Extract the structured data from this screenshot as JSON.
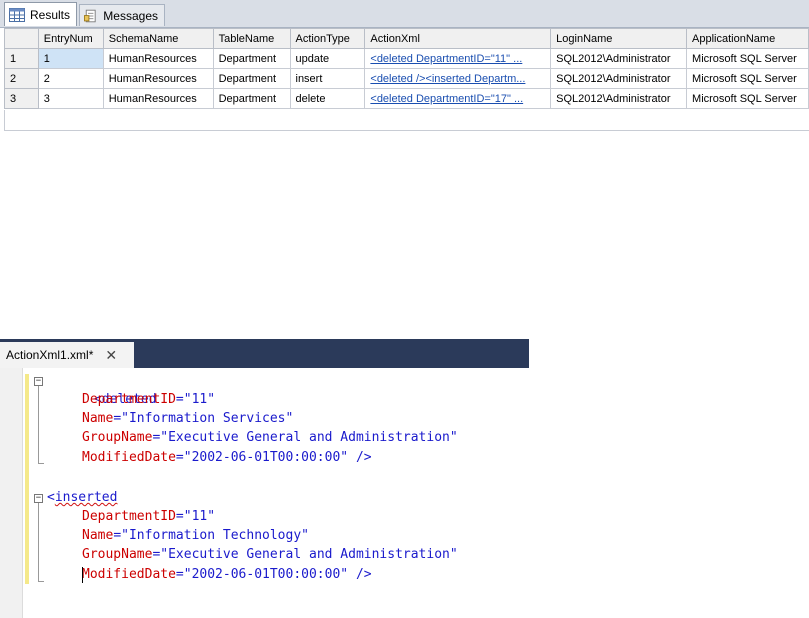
{
  "results_tabs": [
    {
      "label": "Results",
      "icon": "grid-icon"
    },
    {
      "label": "Messages",
      "icon": "document-icon"
    }
  ],
  "grid": {
    "columns": [
      "EntryNum",
      "SchemaName",
      "TableName",
      "ActionType",
      "ActionXml",
      "LoginName",
      "ApplicationName"
    ],
    "rows": [
      {
        "row_num": "1",
        "cells": [
          "1",
          "HumanResources",
          "Department",
          "update",
          "<deleted DepartmentID=\"11\" ...",
          "SQL2012\\Administrator",
          "Microsoft SQL Server"
        ]
      },
      {
        "row_num": "2",
        "cells": [
          "2",
          "HumanResources",
          "Department",
          "insert",
          "<deleted /><inserted Departm...",
          "SQL2012\\Administrator",
          "Microsoft SQL Server"
        ]
      },
      {
        "row_num": "3",
        "cells": [
          "3",
          "HumanResources",
          "Department",
          "delete",
          "<deleted DepartmentID=\"17\" ...",
          "SQL2012\\Administrator",
          "Microsoft SQL Server"
        ]
      }
    ]
  },
  "editor": {
    "tab_title": "ActionXml1.xml*",
    "close_glyph": "✕",
    "deleted": {
      "tag_open": "<deleted",
      "attrs": [
        {
          "name": "DepartmentID",
          "value": "\"11\""
        },
        {
          "name": "Name",
          "value": "\"Information Services\""
        },
        {
          "name": "GroupName",
          "value": "\"Executive General and Administration\""
        },
        {
          "name": "ModifiedDate",
          "value": "\"2002-06-01T00:00:00\"",
          "close": " />"
        }
      ]
    },
    "inserted": {
      "tag_bracket": "<",
      "tag_name": "inserted",
      "attrs": [
        {
          "name": "DepartmentID",
          "value": "\"11\""
        },
        {
          "name": "Name",
          "value": "\"Information Technology\""
        },
        {
          "name": "GroupName",
          "value": "\"Executive General and Administration\""
        },
        {
          "name": "ModifiedDate",
          "value": "\"2002-06-01T00:00:00\"",
          "close": " />"
        }
      ]
    },
    "fold_glyph": "−",
    "equals": "="
  }
}
